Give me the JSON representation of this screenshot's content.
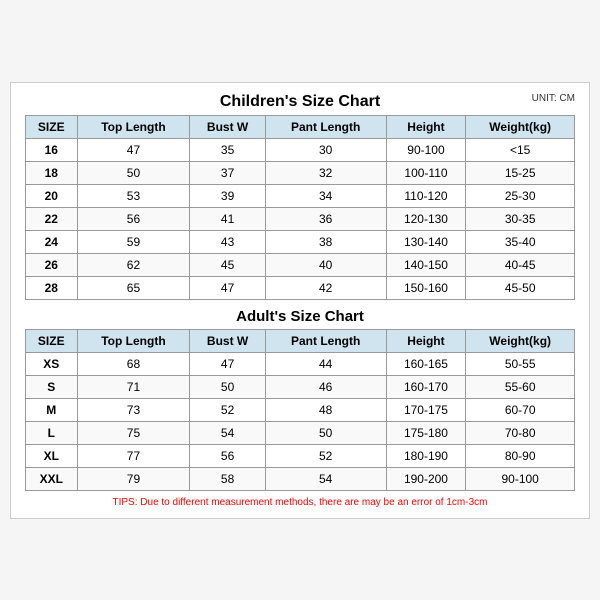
{
  "page": {
    "title": "Children's Size Chart",
    "unit": "UNIT: CM",
    "adult_title": "Adult's Size Chart",
    "tips": "TIPS: Due to different measurement methods, there are may be an error of 1cm-3cm",
    "children_headers": [
      "SIZE",
      "Top Length",
      "Bust W",
      "Pant Length",
      "Height",
      "Weight(kg)"
    ],
    "adult_headers": [
      "SIZE",
      "Top Length",
      "Bust W",
      "Pant Length",
      "Height",
      "Weight(kg)"
    ],
    "children_rows": [
      [
        "16",
        "47",
        "35",
        "30",
        "90-100",
        "<15"
      ],
      [
        "18",
        "50",
        "37",
        "32",
        "100-110",
        "15-25"
      ],
      [
        "20",
        "53",
        "39",
        "34",
        "110-120",
        "25-30"
      ],
      [
        "22",
        "56",
        "41",
        "36",
        "120-130",
        "30-35"
      ],
      [
        "24",
        "59",
        "43",
        "38",
        "130-140",
        "35-40"
      ],
      [
        "26",
        "62",
        "45",
        "40",
        "140-150",
        "40-45"
      ],
      [
        "28",
        "65",
        "47",
        "42",
        "150-160",
        "45-50"
      ]
    ],
    "adult_rows": [
      [
        "XS",
        "68",
        "47",
        "44",
        "160-165",
        "50-55"
      ],
      [
        "S",
        "71",
        "50",
        "46",
        "160-170",
        "55-60"
      ],
      [
        "M",
        "73",
        "52",
        "48",
        "170-175",
        "60-70"
      ],
      [
        "L",
        "75",
        "54",
        "50",
        "175-180",
        "70-80"
      ],
      [
        "XL",
        "77",
        "56",
        "52",
        "180-190",
        "80-90"
      ],
      [
        "XXL",
        "79",
        "58",
        "54",
        "190-200",
        "90-100"
      ]
    ]
  }
}
